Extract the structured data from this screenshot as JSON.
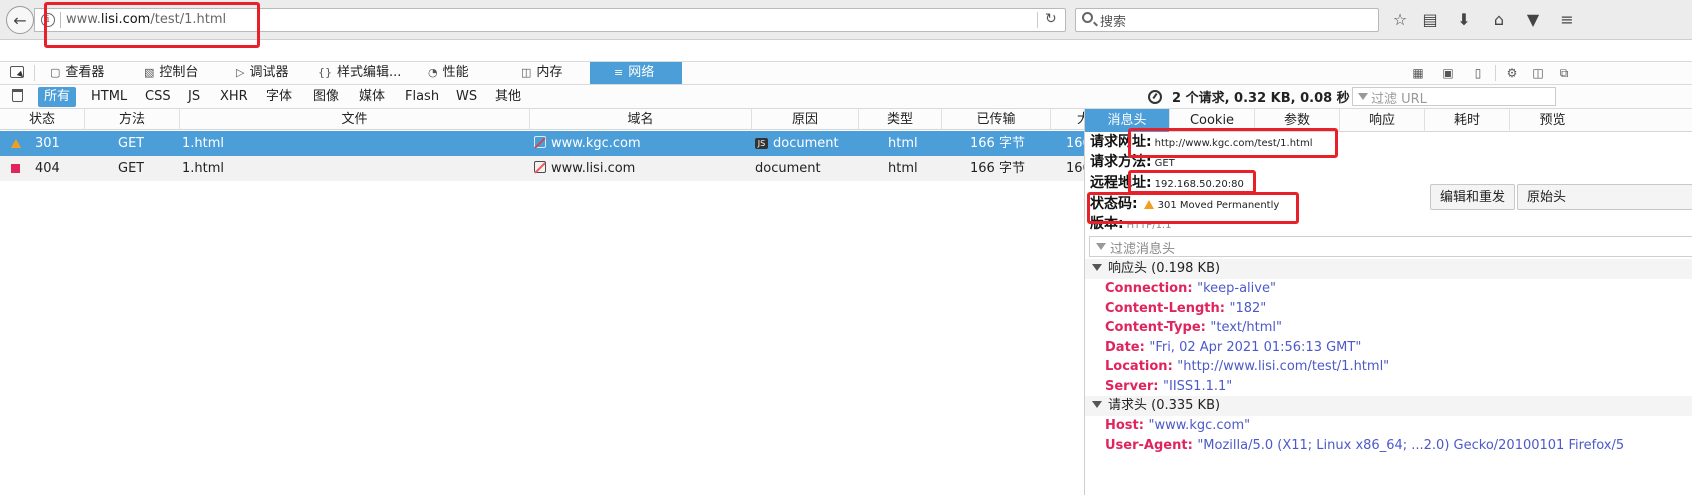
{
  "browser": {
    "url_prefix": "www.",
    "url_host": "lisi.com",
    "url_path": "/test/1.html",
    "search_placeholder": "搜索"
  },
  "toolbox": {
    "tabs": [
      {
        "label": "查看器",
        "icon": "inspector-icon"
      },
      {
        "label": "控制台",
        "icon": "console-icon"
      },
      {
        "label": "调试器",
        "icon": "debugger-icon"
      },
      {
        "label": "样式编辑...",
        "icon": "style-editor-icon"
      },
      {
        "label": "性能",
        "icon": "performance-icon"
      },
      {
        "label": "内存",
        "icon": "memory-icon"
      },
      {
        "label": "网络",
        "icon": "network-icon"
      }
    ],
    "active_tab": "网络"
  },
  "filters": {
    "types": [
      "所有",
      "HTML",
      "CSS",
      "JS",
      "XHR",
      "字体",
      "图像",
      "媒体",
      "Flash",
      "WS",
      "其他"
    ],
    "active": "所有",
    "summary": "2 个请求, 0.32 KB, 0.08 秒",
    "url_filter_placeholder": "过滤 URL"
  },
  "table": {
    "columns": [
      "状态",
      "方法",
      "文件",
      "域名",
      "原因",
      "类型",
      "已传输",
      "大"
    ],
    "rows": [
      {
        "status": "301",
        "method": "GET",
        "file": "1.html",
        "domain": "www.kgc.com",
        "cause": "document",
        "type": "html",
        "transferred": "166 字节",
        "size": "166"
      },
      {
        "status": "404",
        "method": "GET",
        "file": "1.html",
        "domain": "www.lisi.com",
        "cause": "document",
        "type": "html",
        "transferred": "166 字节",
        "size": "166"
      }
    ]
  },
  "details": {
    "tabs": [
      "消息头",
      "Cookie",
      "参数",
      "响应",
      "耗时",
      "预览"
    ],
    "active_tab": "消息头",
    "request_url_label": "请求网址:",
    "request_url": "http://www.kgc.com/test/1.html",
    "method_label": "请求方法:",
    "method": "GET",
    "remote_label": "远程地址:",
    "remote": "192.168.50.20:80",
    "status_label": "状态码:",
    "status": "301  Moved  Permanently",
    "version_label": "版本:",
    "version": "HTTP/1.1",
    "edit_resend_label": "编辑和重发",
    "raw_headers_label": "原始头",
    "header_filter_placeholder": "过滤消息头",
    "response_section": "响应头 (0.198 KB)",
    "response_headers": [
      {
        "name": "Connection",
        "value": "\"keep-alive\""
      },
      {
        "name": "Content-Length",
        "value": "\"182\""
      },
      {
        "name": "Content-Type",
        "value": "\"text/html\""
      },
      {
        "name": "Date",
        "value": "\"Fri, 02 Apr 2021 01:56:13 GMT\""
      },
      {
        "name": "Location",
        "value": "\"http://www.lisi.com/test/1.html\""
      },
      {
        "name": "Server",
        "value": "\"IISS1.1.1\""
      }
    ],
    "request_section": "请求头 (0.335 KB)",
    "request_headers": [
      {
        "name": "Host",
        "value": "\"www.kgc.com\""
      },
      {
        "name": "User-Agent",
        "value": "\"Mozilla/5.0 (X11; Linux x86_64; ...2.0) Gecko/20100101 Firefox/5"
      }
    ]
  },
  "colors": {
    "accent": "#4c9ed9",
    "annotation": "#e8202a",
    "header_name": "#e0245e",
    "header_value": "#4c59c9",
    "warning": "#f0a020",
    "error": "#e0245e"
  }
}
